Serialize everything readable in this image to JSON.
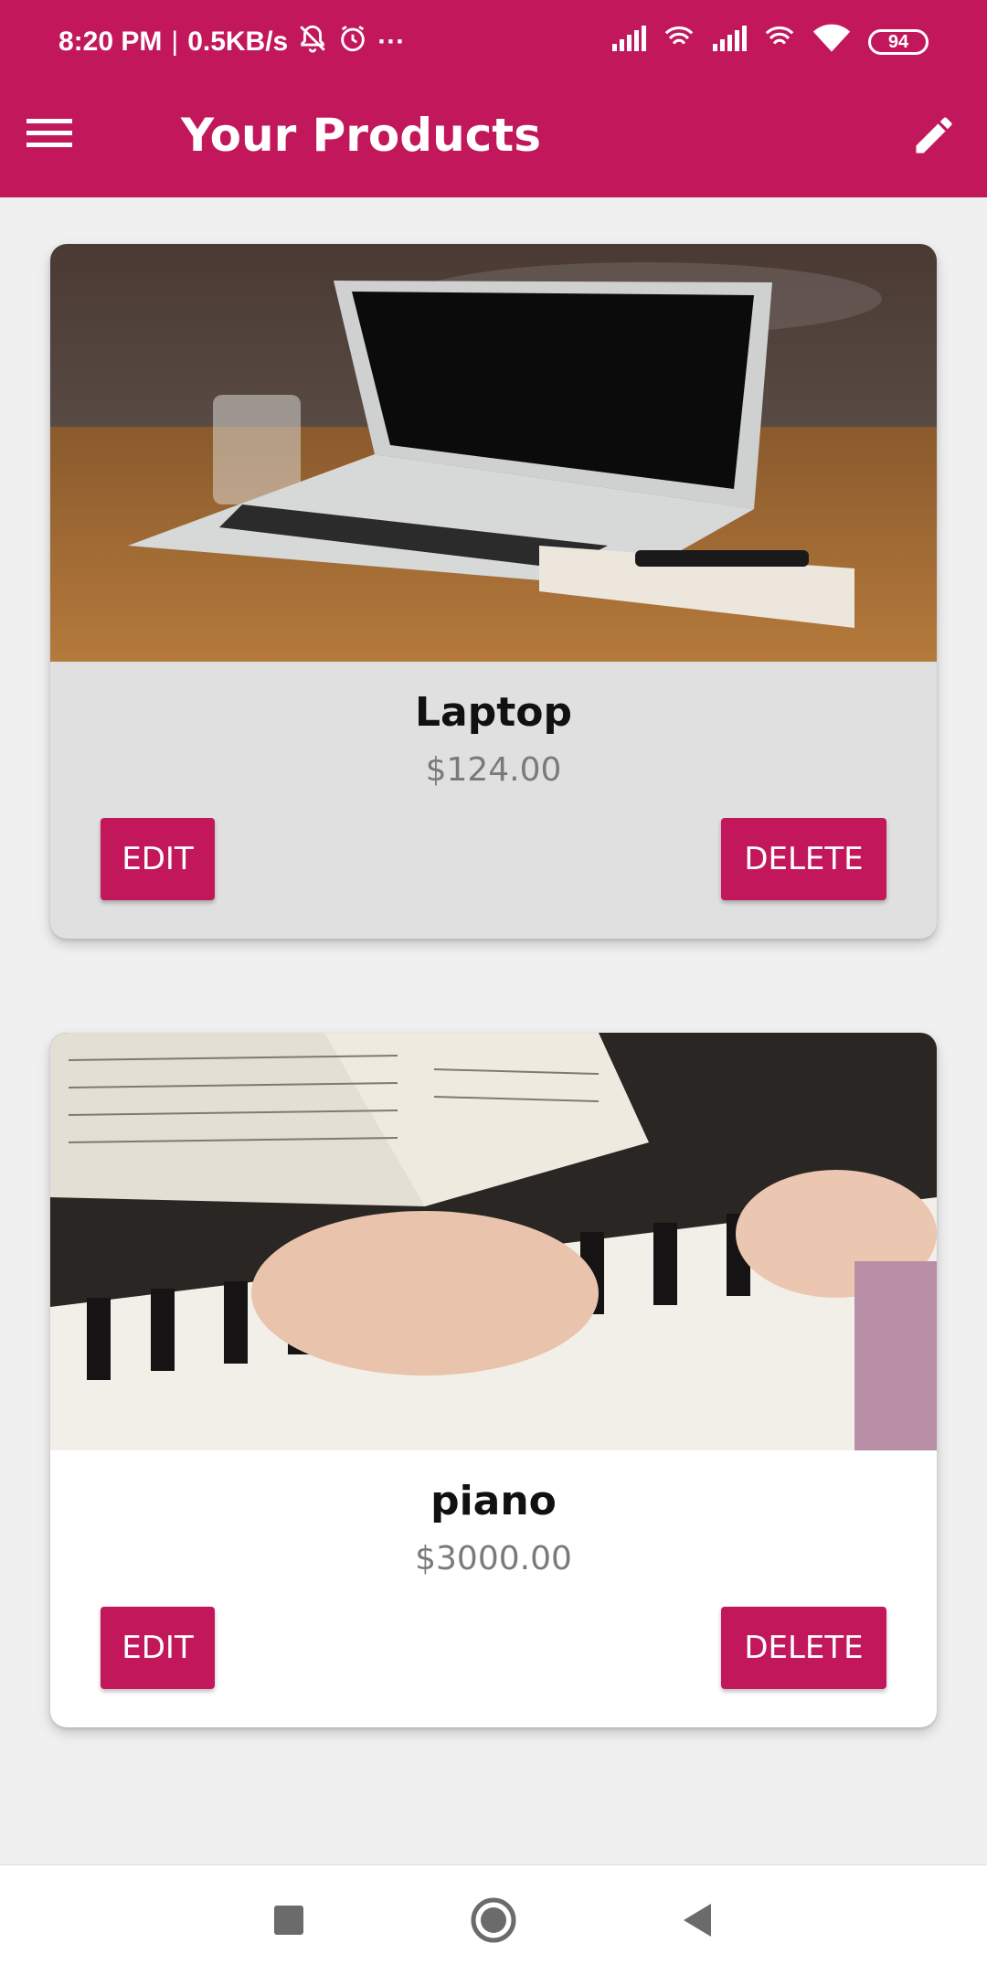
{
  "status_bar": {
    "time": "8:20 PM",
    "speed": "0.5KB/s",
    "separator": "|",
    "more": "···",
    "battery": "94"
  },
  "toolbar": {
    "title": "Your Products"
  },
  "products": [
    {
      "name": "Laptop",
      "price": "$124.00",
      "edit_label": "EDIT",
      "delete_label": "DELETE"
    },
    {
      "name": "piano",
      "price": "$3000.00",
      "edit_label": "EDIT",
      "delete_label": "DELETE"
    }
  ],
  "colors": {
    "primary": "#c2185b",
    "background": "#f0f0f0",
    "card_selected": "#e0e0e0",
    "card_default": "#ffffff"
  },
  "icons": [
    "menu-icon",
    "pencil-icon",
    "bell-off-icon",
    "alarm-icon",
    "signal-icon",
    "wifi-icon",
    "battery-icon",
    "nav-recents-icon",
    "nav-home-icon",
    "nav-back-icon"
  ]
}
